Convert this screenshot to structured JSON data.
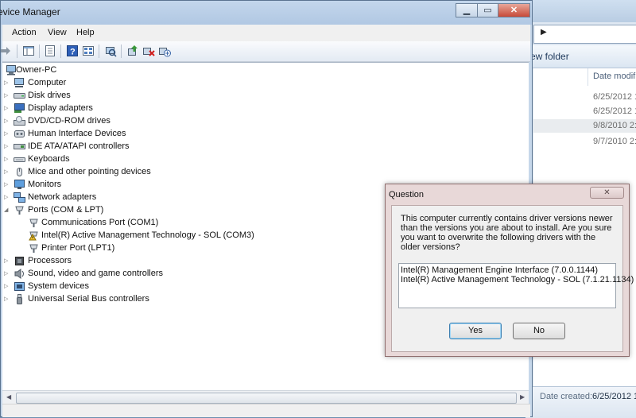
{
  "explorer": {
    "toolbar_label": "New folder",
    "toolbar_label_partial": "ew folder",
    "column_header": "Date modifi",
    "rows": [
      "6/25/2012 1:",
      "6/25/2012 1:",
      "9/8/2010 2:1",
      "9/7/2010 2:4"
    ],
    "details_label": "Date created:",
    "details_value": "6/25/2012 1:"
  },
  "device_manager": {
    "title": "Device Manager",
    "title_partial": "evice Manager",
    "menu": [
      "Action",
      "View",
      "Help"
    ],
    "toolbar_icons": [
      "back-icon",
      "forward-icon",
      "properties-sheet-icon",
      "console-tree-icon",
      "help-icon",
      "view-icon",
      "scan-hardware-icon",
      "update-driver-icon",
      "uninstall-icon",
      "disable-icon"
    ],
    "root": "Owner-PC",
    "categories": [
      {
        "label": "Computer",
        "icon": "computer-icon"
      },
      {
        "label": "Disk drives",
        "icon": "disk-drive-icon"
      },
      {
        "label": "Display adapters",
        "icon": "display-adapter-icon"
      },
      {
        "label": "DVD/CD-ROM drives",
        "icon": "dvd-drive-icon"
      },
      {
        "label": "Human Interface Devices",
        "icon": "hid-icon"
      },
      {
        "label": "IDE ATA/ATAPI controllers",
        "icon": "ide-controller-icon"
      },
      {
        "label": "Keyboards",
        "icon": "keyboard-icon"
      },
      {
        "label": "Mice and other pointing devices",
        "icon": "mouse-icon"
      },
      {
        "label": "Monitors",
        "icon": "monitor-icon"
      },
      {
        "label": "Network adapters",
        "icon": "network-adapter-icon"
      },
      {
        "label": "Ports (COM & LPT)",
        "icon": "port-icon"
      },
      {
        "label": "Processors",
        "icon": "processor-icon"
      },
      {
        "label": "Sound, video and game controllers",
        "icon": "sound-icon"
      },
      {
        "label": "System devices",
        "icon": "system-device-icon"
      },
      {
        "label": "Universal Serial Bus controllers",
        "icon": "usb-icon"
      }
    ],
    "ports_children": [
      "Communications Port (COM1)",
      "Intel(R) Active Management Technology - SOL (COM3)",
      "Printer Port (LPT1)"
    ]
  },
  "dialog": {
    "title": "Question",
    "message": "This computer currently contains driver versions newer than the versions you are about to install. Are you sure you want to overwrite the following drivers with the older versions?",
    "drivers": [
      "Intel(R) Management Engine Interface (7.0.0.1144)",
      "Intel(R) Active Management Technology - SOL (7.1.21.1134)"
    ],
    "yes_label": "Yes",
    "no_label": "No",
    "close_glyph": "✕"
  },
  "colors": {
    "titlebar": "#b8cde6",
    "dialog_frame": "#e8d8d8",
    "close_button": "#c74a38",
    "default_button_border": "#3c7fb1"
  }
}
